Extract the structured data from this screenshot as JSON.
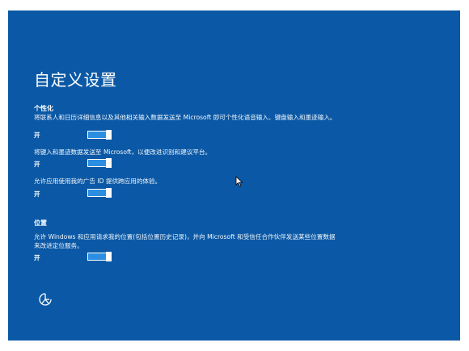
{
  "page": {
    "title": "自定义设置"
  },
  "personalization": {
    "heading": "个性化",
    "items": [
      {
        "description": "将联系人和日历详细信息以及其他相关输入数据发送至 Microsoft 即可个性化语音输入、键盘输入和墨迹输入。",
        "state_label": "开",
        "on": true
      },
      {
        "description": "将键入和墨迹数据发送至 Microsoft，以便改进识别和建议平台。",
        "state_label": "开",
        "on": true
      },
      {
        "description": "允许应用使用我的广告 ID 提供跨应用的体验。",
        "state_label": "开",
        "on": true
      }
    ]
  },
  "location": {
    "heading": "位置",
    "items": [
      {
        "description": "允许 Windows 和应用请求我的位置(包括位置历史记录)，并向 Microsoft 和受信任合作伙伴发送某些位置数据来改进定位服务。",
        "state_label": "开",
        "on": true
      }
    ]
  },
  "icons": {
    "ease_of_access": "ease-of-access-icon",
    "cursor": "mouse-pointer-icon"
  },
  "colors": {
    "background": "#0b59a6",
    "toggle_on": "#2b8ee0",
    "text": "#ffffff"
  }
}
